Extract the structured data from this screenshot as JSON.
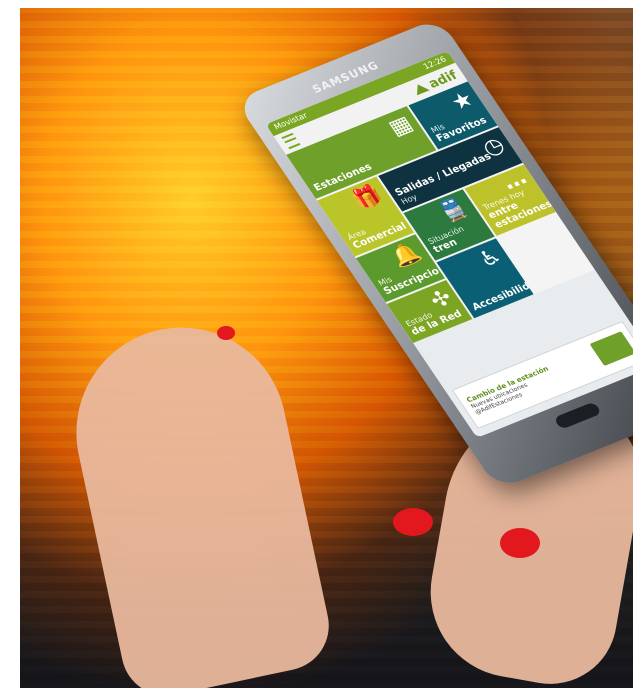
{
  "phone": {
    "brand": "SAMSUNG"
  },
  "screen": {
    "status_time": "12:26",
    "status_left": "Movistar",
    "logo_text": "adif",
    "tiles": {
      "estaciones": "Estaciones",
      "mis_favoritos_1": "Mis",
      "mis_favoritos_2": "Favoritos",
      "area_1": "Área",
      "area_2": "Comercial",
      "salidas_1": "Salidas / Llegadas",
      "salidas_2": "Hoy",
      "susc_1": "Mis",
      "susc_2": "Suscripciones",
      "sit_1": "Situación",
      "sit_2": "tren",
      "trenes_1": "Trenes hoy",
      "trenes_2": "entre estaciones",
      "estado_1": "Estado",
      "estado_2": "de la Red",
      "accesibilidad": "Accesibilidad"
    },
    "banner": {
      "title": "Cambio de la estación",
      "line2": "Nuevas ubicaciones",
      "line3": "@AdifEstaciones"
    }
  },
  "colors": {
    "adif_green": "#6c9a1c",
    "tile_dark": "#0f3240",
    "nail": "#e3171e"
  }
}
